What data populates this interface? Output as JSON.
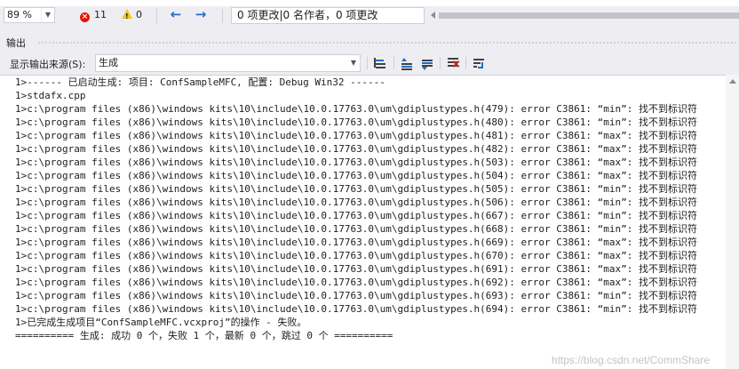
{
  "statusbar": {
    "zoom": "89 %",
    "error_count": "11",
    "warning_count": "0",
    "codelens": "0 项更改|0 名作者，0 项更改",
    "icons": {
      "error": "error-circle-icon",
      "warning": "warning-triangle-icon",
      "back": "arrow-left-icon",
      "forward": "arrow-right-icon"
    }
  },
  "panel": {
    "title": "输出",
    "source_label": "显示输出来源(S):",
    "source_value": "生成",
    "toolbar_icons": [
      "find-message-in-code-icon",
      "previous-message-icon",
      "next-message-icon",
      "clear-all-icon",
      "toggle-word-wrap-icon"
    ]
  },
  "output": {
    "lines": [
      "1>------ 已启动生成: 项目: ConfSampleMFC, 配置: Debug Win32 ------",
      "1>stdafx.cpp",
      "1>c:\\program files (x86)\\windows kits\\10\\include\\10.0.17763.0\\um\\gdiplustypes.h(479): error C3861: “min”: 找不到标识符",
      "1>c:\\program files (x86)\\windows kits\\10\\include\\10.0.17763.0\\um\\gdiplustypes.h(480): error C3861: “min”: 找不到标识符",
      "1>c:\\program files (x86)\\windows kits\\10\\include\\10.0.17763.0\\um\\gdiplustypes.h(481): error C3861: “max”: 找不到标识符",
      "1>c:\\program files (x86)\\windows kits\\10\\include\\10.0.17763.0\\um\\gdiplustypes.h(482): error C3861: “max”: 找不到标识符",
      "1>c:\\program files (x86)\\windows kits\\10\\include\\10.0.17763.0\\um\\gdiplustypes.h(503): error C3861: “max”: 找不到标识符",
      "1>c:\\program files (x86)\\windows kits\\10\\include\\10.0.17763.0\\um\\gdiplustypes.h(504): error C3861: “max”: 找不到标识符",
      "1>c:\\program files (x86)\\windows kits\\10\\include\\10.0.17763.0\\um\\gdiplustypes.h(505): error C3861: “min”: 找不到标识符",
      "1>c:\\program files (x86)\\windows kits\\10\\include\\10.0.17763.0\\um\\gdiplustypes.h(506): error C3861: “min”: 找不到标识符",
      "1>c:\\program files (x86)\\windows kits\\10\\include\\10.0.17763.0\\um\\gdiplustypes.h(667): error C3861: “min”: 找不到标识符",
      "1>c:\\program files (x86)\\windows kits\\10\\include\\10.0.17763.0\\um\\gdiplustypes.h(668): error C3861: “min”: 找不到标识符",
      "1>c:\\program files (x86)\\windows kits\\10\\include\\10.0.17763.0\\um\\gdiplustypes.h(669): error C3861: “max”: 找不到标识符",
      "1>c:\\program files (x86)\\windows kits\\10\\include\\10.0.17763.0\\um\\gdiplustypes.h(670): error C3861: “max”: 找不到标识符",
      "1>c:\\program files (x86)\\windows kits\\10\\include\\10.0.17763.0\\um\\gdiplustypes.h(691): error C3861: “max”: 找不到标识符",
      "1>c:\\program files (x86)\\windows kits\\10\\include\\10.0.17763.0\\um\\gdiplustypes.h(692): error C3861: “max”: 找不到标识符",
      "1>c:\\program files (x86)\\windows kits\\10\\include\\10.0.17763.0\\um\\gdiplustypes.h(693): error C3861: “min”: 找不到标识符",
      "1>c:\\program files (x86)\\windows kits\\10\\include\\10.0.17763.0\\um\\gdiplustypes.h(694): error C3861: “min”: 找不到标识符",
      "1>已完成生成项目“ConfSampleMFC.vcxproj”的操作 - 失败。",
      "========== 生成: 成功 0 个，失败 1 个，最新 0 个，跳过 0 个 =========="
    ],
    "watermark": "https://blog.csdn.net/CommShare"
  }
}
